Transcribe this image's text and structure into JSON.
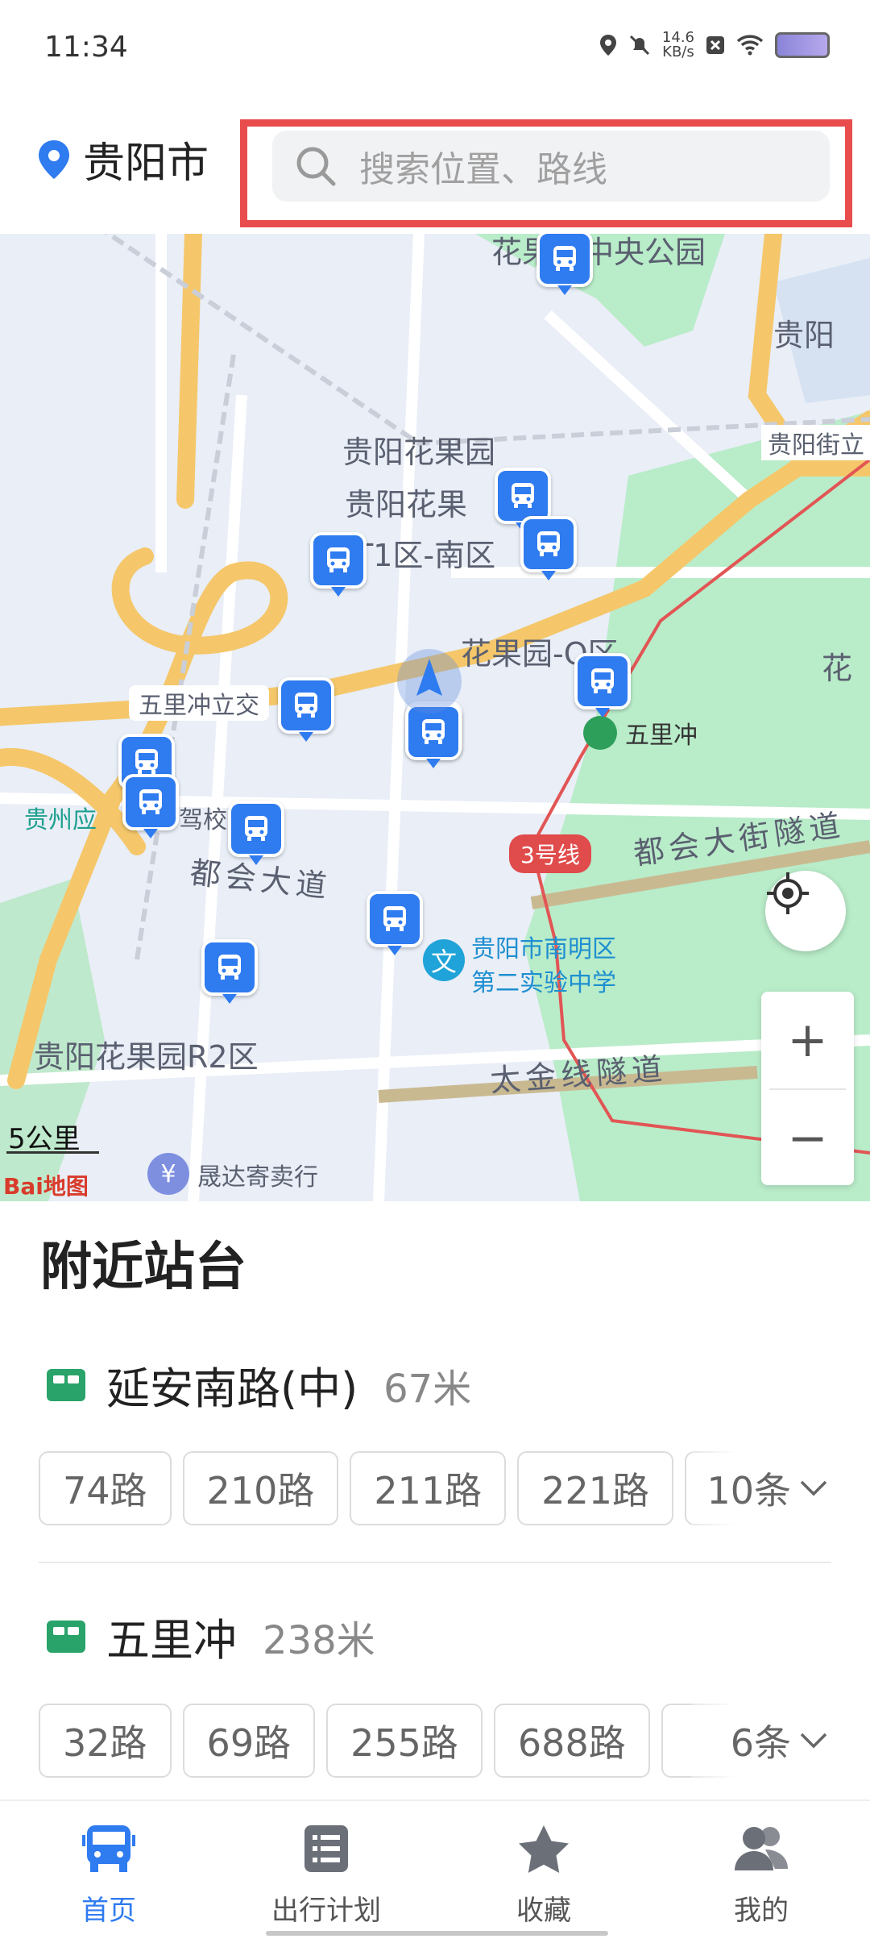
{
  "status_bar": {
    "time": "11:34",
    "net_speed_value": "14.6",
    "net_speed_unit": "KB/s",
    "icons": [
      "location-icon",
      "mute-icon",
      "close-box-icon",
      "wifi-icon",
      "battery-icon"
    ]
  },
  "header": {
    "city": "贵阳市",
    "search_placeholder": "搜索位置、路线"
  },
  "map": {
    "labels": [
      "花果园中央公园",
      "贵阳花果园",
      "贵阳花果",
      "T1区-南区",
      "贵阳街立",
      "贵阳",
      "花果园-Q区",
      "花",
      "五里冲立交",
      "五里冲",
      "贵州应",
      "驾校",
      "都会大道",
      "都会大街隧道",
      "贵阳市南明区",
      "第二实验中学",
      "贵阳花果园R2区",
      "太金线隧道",
      "晟达寄卖行"
    ],
    "metro_line": "3号线",
    "scale": "5公里",
    "logo": "Bai地图",
    "zoom_in": "+",
    "zoom_out": "−"
  },
  "nearby": {
    "title": "附近站台",
    "stations": [
      {
        "name": "延安南路(中)",
        "distance": "67米",
        "routes": [
          "74路",
          "210路",
          "211路",
          "221路"
        ],
        "more": "10条"
      },
      {
        "name": "五里冲",
        "distance": "238米",
        "routes": [
          "32路",
          "69路",
          "255路",
          "688路"
        ],
        "more": "6条"
      }
    ]
  },
  "bottom_nav": {
    "items": [
      {
        "label": "首页",
        "icon": "bus-icon",
        "active": true
      },
      {
        "label": "出行计划",
        "icon": "list-icon",
        "active": false
      },
      {
        "label": "收藏",
        "icon": "star-icon",
        "active": false
      },
      {
        "label": "我的",
        "icon": "user-icon",
        "active": false
      }
    ]
  },
  "colors": {
    "accent": "#2f7bf0",
    "highlight_border": "#e84c4c",
    "park": "#b9ecc9",
    "road": "#f5c76a"
  }
}
